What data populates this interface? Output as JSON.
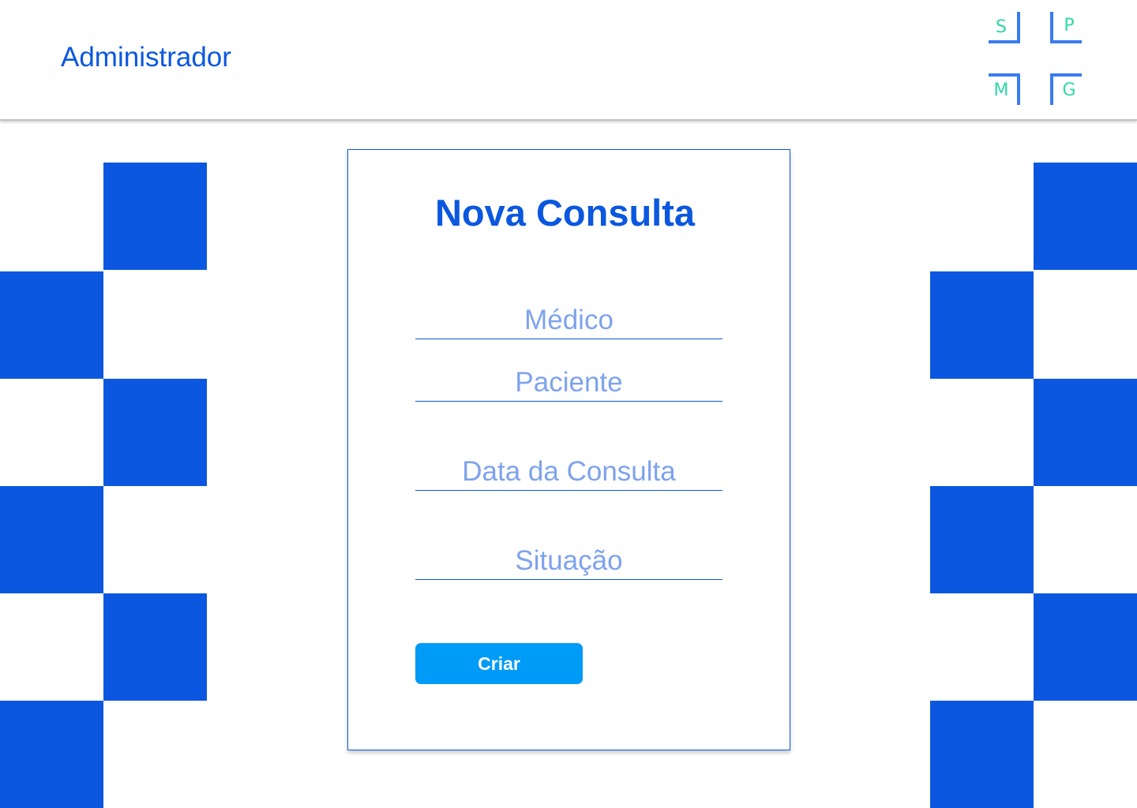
{
  "header": {
    "title": "Administrador",
    "logo": {
      "letters": [
        "S",
        "P",
        "M",
        "G"
      ],
      "letter_color": "#2ed8a8",
      "bracket_color": "#3a7bf0"
    }
  },
  "form": {
    "title": "Nova Consulta",
    "fields": [
      {
        "name": "medico",
        "value": "",
        "placeholder": "Médico"
      },
      {
        "name": "paciente",
        "value": "",
        "placeholder": "Paciente"
      },
      {
        "name": "data-consulta",
        "value": "",
        "placeholder": "Data da Consulta"
      },
      {
        "name": "situacao",
        "value": "",
        "placeholder": "Situação"
      }
    ],
    "submit_label": "Criar"
  },
  "colors": {
    "primary": "#0b57df",
    "button": "#009af7",
    "placeholder": "#7ea3ec"
  }
}
